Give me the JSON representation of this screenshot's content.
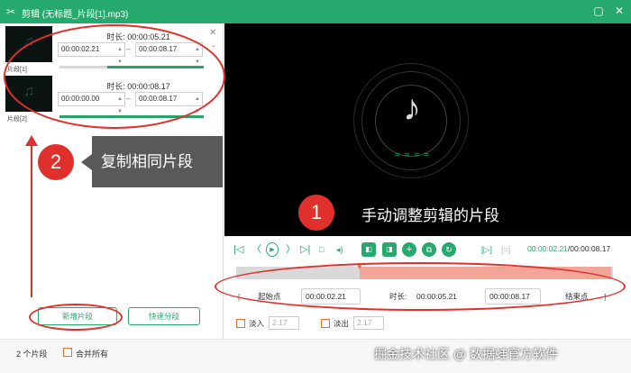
{
  "window": {
    "app_icon": "scissors-icon",
    "title": "剪辑 (无标题_片段[1].mp3)"
  },
  "segments": [
    {
      "label": "片段[1]",
      "duration_label": "时长:",
      "duration": "00:00:05.21",
      "start": "00:00:02.21",
      "end": "00:00:08.17",
      "progress_fraction_start": 0.33,
      "progress_fraction_end": 1.0
    },
    {
      "label": "片段[2]",
      "duration_label": "时长:",
      "duration": "00:00:08.17",
      "start": "00:00:00.00",
      "end": "00:00:08.17",
      "progress_fraction_start": 0.0,
      "progress_fraction_end": 1.0
    }
  ],
  "dash": "–",
  "buttons": {
    "add_segment": "新增片段",
    "quick_split": "快速分段"
  },
  "tooltip": {
    "badge": "2",
    "text": "复制相同片段"
  },
  "preview": {
    "badge": "1",
    "caption": "手动调整剪辑的片段",
    "equalizer": "= = = ="
  },
  "player": {
    "current": "00:00:02.21",
    "separator": "/",
    "total": "00:00:08.17"
  },
  "range": {
    "start_label": "起始点",
    "start_value": "00:00:02.21",
    "duration_label": "时长:",
    "duration_value": "00:00:05.21",
    "end_value": "00:00:08.17",
    "end_label": "结束点"
  },
  "fade": {
    "in_label": "淡入",
    "in_value": "2.17",
    "out_label": "淡出",
    "out_value": "2.17"
  },
  "status": {
    "count": "2 个片段",
    "merge_label": "合并所有"
  },
  "watermark": "掘金技术社区 @ 数据蛙官方软件",
  "colors": {
    "accent": "#26a96c",
    "annotation": "#e0302c",
    "selection": "#f2a69a"
  }
}
